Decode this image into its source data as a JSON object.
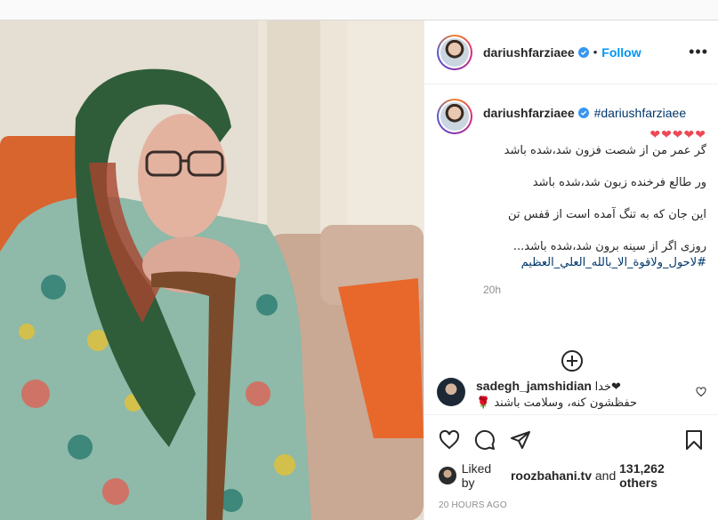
{
  "post": {
    "author": "dariushfarziaee",
    "follow_label": "Follow",
    "dot": "•",
    "more_label": "•••"
  },
  "caption": {
    "username": "dariushfarziaee",
    "hashtag": "#dariushfarziaee",
    "hearts": "❤❤❤❤❤",
    "lines": [
      "گر عمر من از شصت فزون شد،شده باشد",
      "ور طالع فرخنده زبون شد،شده باشد",
      "این جان که به تنگ آمده است از قفس تن",
      "روزی اگر از سینه برون شد،شده باشد..."
    ],
    "tag_line": "#لاحول_ولاقوة_الا_بالله_العلي_العظيم",
    "time": "20h"
  },
  "comment": {
    "username": "sadegh_jamshidian",
    "text_line1": "خدا❤",
    "text_line2": "حفظشون کنه، وسلامت باشند 🌹"
  },
  "likes": {
    "prefix": "Liked by",
    "liker": "roozbahani.tv",
    "and": "and",
    "count": "131,262 others"
  },
  "timestamp": "20 HOURS AGO",
  "icons": {
    "verified": "verified-badge-icon",
    "heart": "heart-icon",
    "comment": "comment-icon",
    "share": "share-icon",
    "save": "bookmark-icon",
    "load_more": "plus-circle-icon"
  },
  "colors": {
    "link": "#0095f6",
    "hashtag": "#00376b",
    "muted": "#8e8e8e",
    "heart": "#ed4956"
  }
}
